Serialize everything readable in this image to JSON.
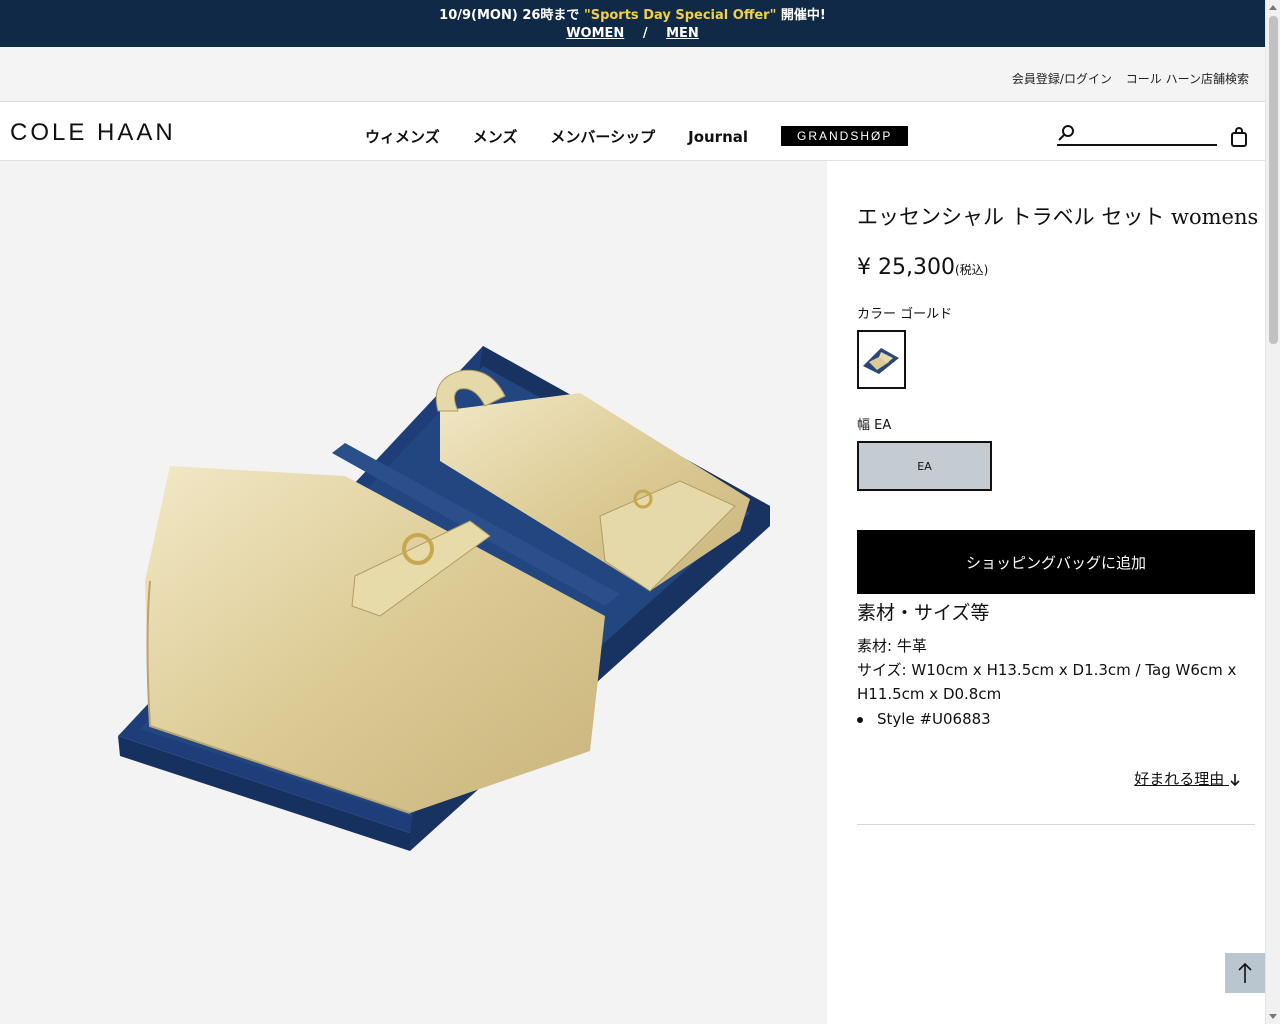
{
  "promo": {
    "line1_prefix": "10/9(MON) 26時まで ",
    "line1_highlight": "\"Sports Day Special Offer\"",
    "line1_suffix": " 開催中!",
    "women_link": "WOMEN",
    "separator": "/",
    "men_link": "MEN",
    "accent_color": "#f3d046"
  },
  "utility": {
    "login": "会員登録/ログイン",
    "store_search": "コール ハーン店舗検索"
  },
  "header": {
    "logo": "COLE HAAN",
    "nav": [
      "ウィメンズ",
      "メンズ",
      "メンバーシップ",
      "Journal"
    ],
    "grandshop": "GRANDSHØP",
    "search_placeholder": ""
  },
  "product": {
    "title": "エッセンシャル トラベル セット womens",
    "price": "¥ 25,300",
    "tax_note": "(税込)",
    "color_label": "カラー ゴールド",
    "width_label": "幅 EA",
    "width_option": "EA",
    "add_to_bag": "ショッピングバッグに追加",
    "spec_title": "素材・サイズ等",
    "material": "素材: 牛革",
    "size": "サイズ: W10cm x H13.5cm x D1.3cm / Tag W6cm x H11.5cm x D0.8cm",
    "style": "Style #U06883",
    "reason_link": "好まれる理由"
  }
}
